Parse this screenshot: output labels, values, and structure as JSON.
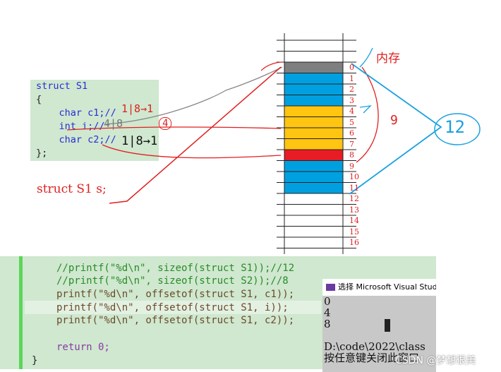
{
  "struct_code": {
    "lines": [
      "struct S1",
      "{",
      "    char c1;//",
      "    int i;//",
      "    char c2;//",
      "};"
    ]
  },
  "main_code": {
    "lines": [
      "//printf(\"%d\\n\", sizeof(struct S1));//12",
      "//printf(\"%d\\n\", sizeof(struct S2));//8",
      "printf(\"%d\\n\", offsetof(struct S1, c1));",
      "printf(\"%d\\n\", offsetof(struct S1, i));",
      "printf(\"%d\\n\", offsetof(struct S1, c2));",
      "",
      "return 0;",
      "}"
    ]
  },
  "console": {
    "title": "选择 Microsoft Visual Studio",
    "output": [
      "0",
      "4",
      "8",
      "",
      "D:\\code\\2022\\class",
      "按任意键关闭此窗口"
    ]
  },
  "memory": {
    "label": "内存",
    "offsets": [
      "0",
      "1",
      "2",
      "3",
      "4",
      "5",
      "6",
      "7",
      "8",
      "9",
      "10",
      "11",
      "12",
      "13",
      "14",
      "15",
      "16"
    ],
    "cells": [
      {
        "member": "c1",
        "from": 0,
        "to": 0,
        "color": "#7f7f7f"
      },
      {
        "member": "padding",
        "from": 1,
        "to": 3,
        "color": "#00a0e0"
      },
      {
        "member": "i",
        "from": 4,
        "to": 7,
        "color": "#ffc510"
      },
      {
        "member": "c2",
        "from": 8,
        "to": 8,
        "color": "#e81c24"
      },
      {
        "member": "padding",
        "from": 9,
        "to": 11,
        "color": "#00a0e0"
      }
    ]
  },
  "annotations": {
    "declaration": "struct S1 s;",
    "c1_note": "1|8→1",
    "i_note": "4|8",
    "i_circled": "4",
    "c2_note": "1|8→1",
    "nine": "9",
    "total": "12"
  },
  "watermark": "CSDN @梦想很美"
}
